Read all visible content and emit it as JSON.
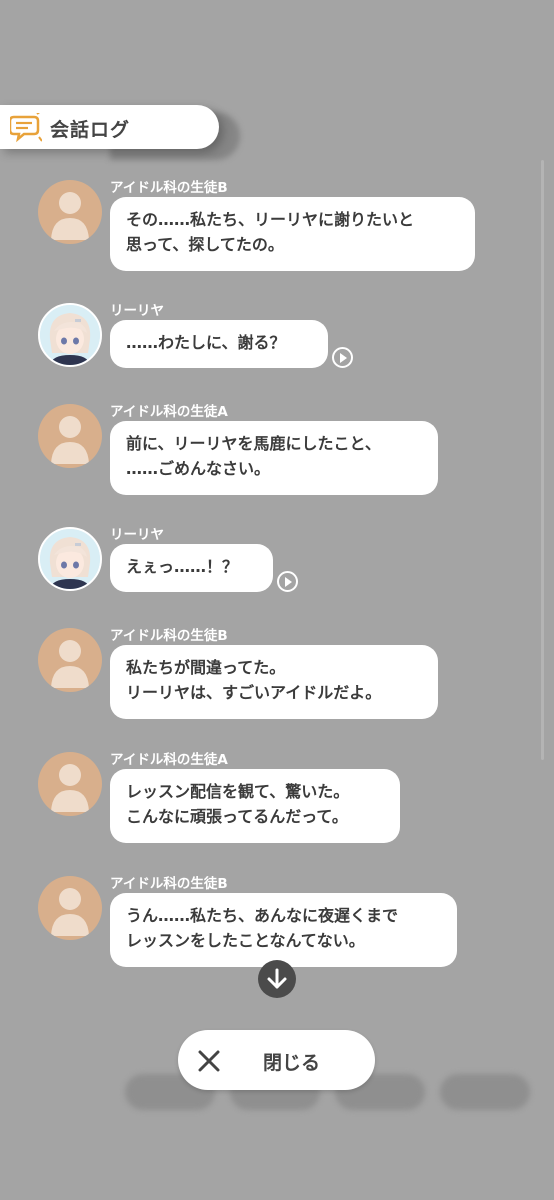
{
  "header": {
    "title": "会話ログ",
    "icon": "chat-log-icon",
    "accent": "#e8a23a"
  },
  "messages": [
    {
      "speaker": "アイドル科の生徒B",
      "avatar": "generic",
      "lines": [
        "その……私たち、リーリヤに謝りたいと",
        "思って、探してたの。"
      ],
      "voice": false
    },
    {
      "speaker": "リーリヤ",
      "avatar": "character",
      "lines": [
        "……わたしに、謝る？"
      ],
      "voice": true
    },
    {
      "speaker": "アイドル科の生徒A",
      "avatar": "generic",
      "lines": [
        "前に、リーリヤを馬鹿にしたこと、",
        "……ごめんなさい。"
      ],
      "voice": false
    },
    {
      "speaker": "リーリヤ",
      "avatar": "character",
      "lines": [
        "えぇっ……！？"
      ],
      "voice": true
    },
    {
      "speaker": "アイドル科の生徒B",
      "avatar": "generic",
      "lines": [
        "私たちが間違ってた。",
        "リーリヤは、すごいアイドルだよ。"
      ],
      "voice": false
    },
    {
      "speaker": "アイドル科の生徒A",
      "avatar": "generic",
      "lines": [
        "レッスン配信を観て、驚いた。",
        "こんなに頑張ってるんだって。"
      ],
      "voice": false
    },
    {
      "speaker": "アイドル科の生徒B",
      "avatar": "generic",
      "lines": [
        "うん……私たち、あんなに夜遅くまで",
        "レッスンをしたことなんてない。"
      ],
      "voice": false
    }
  ],
  "controls": {
    "close_label": "閉じる",
    "close_icon": "close-icon",
    "scroll_icon": "arrow-down-icon"
  },
  "colors": {
    "overlay": "#a4a4a4",
    "generic_avatar": "#d8af8c",
    "bubble": "#ffffff"
  }
}
